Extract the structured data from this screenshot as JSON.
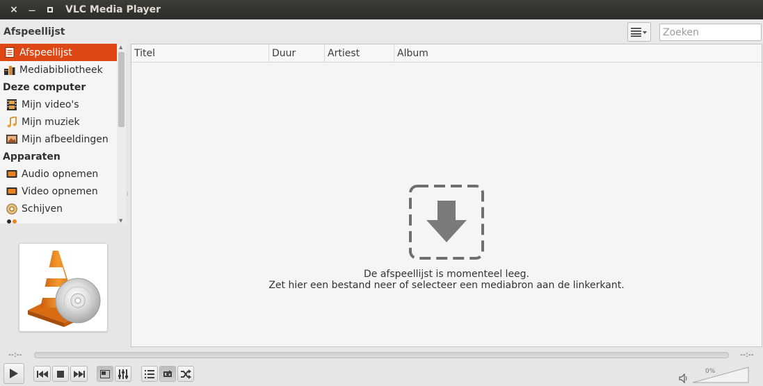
{
  "window": {
    "title": "VLC Media Player",
    "close_glyph": "×",
    "minimize_glyph": "—"
  },
  "toolbar": {
    "label": "Afspeellijst",
    "search_placeholder": "Zoeken",
    "view_icon": "list-view-icon"
  },
  "sidebar": {
    "items": [
      {
        "label": "Afspeellijst",
        "kind": "item",
        "icon": "playlist-icon",
        "selected": true
      },
      {
        "label": "Mediabibliotheek",
        "kind": "item",
        "icon": "media-library-icon"
      },
      {
        "label": "Deze computer",
        "kind": "group"
      },
      {
        "label": "Mijn video's",
        "kind": "sub",
        "icon": "film-icon"
      },
      {
        "label": "Mijn muziek",
        "kind": "sub",
        "icon": "music-note-icon"
      },
      {
        "label": "Mijn afbeeldingen",
        "kind": "sub",
        "icon": "picture-icon"
      },
      {
        "label": "Apparaten",
        "kind": "group"
      },
      {
        "label": "Audio opnemen",
        "kind": "sub",
        "icon": "capture-icon"
      },
      {
        "label": "Video opnemen",
        "kind": "sub",
        "icon": "capture-icon"
      },
      {
        "label": "Schijven",
        "kind": "sub",
        "icon": "disc-icon"
      }
    ]
  },
  "playlist": {
    "columns": [
      "Titel",
      "Duur",
      "Artiest",
      "Album"
    ],
    "empty_line1": "De afspeellijst is momenteel leeg.",
    "empty_line2": "Zet hier een bestand neer of selecteer een mediabron aan de linkerkant."
  },
  "seek": {
    "elapsed": "--:--",
    "remaining": "--:--"
  },
  "volume": {
    "percent_label": "0%",
    "level": 0
  },
  "colors": {
    "accent": "#dd4814",
    "titlebar": "#3d3c38"
  }
}
